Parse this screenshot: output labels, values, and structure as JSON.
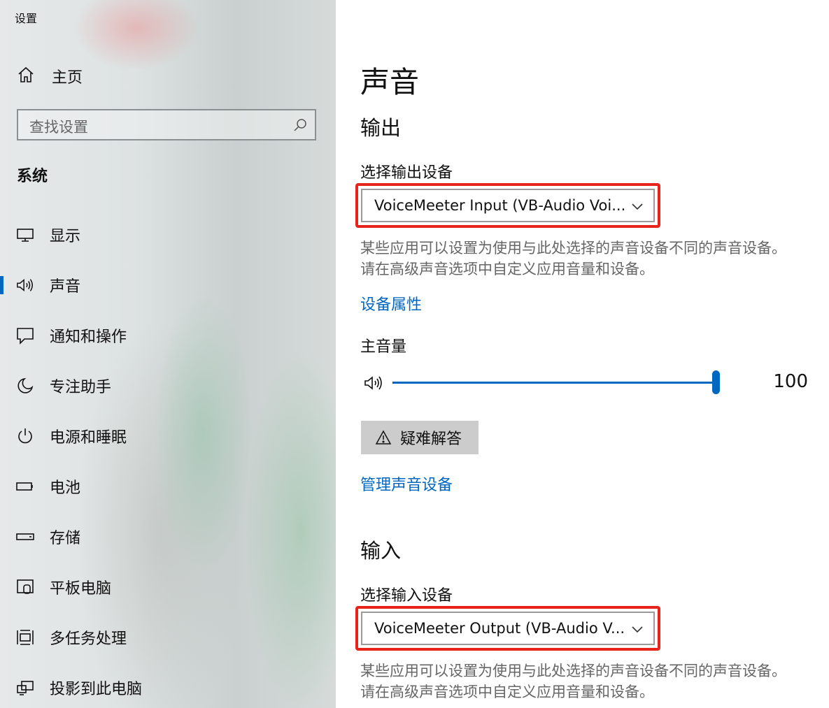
{
  "window": {
    "title": "设置"
  },
  "sidebar": {
    "home_label": "主页",
    "search_placeholder": "查找设置",
    "section_label": "系统",
    "items": [
      {
        "label": "显示",
        "icon": "monitor-icon"
      },
      {
        "label": "声音",
        "icon": "speaker-icon",
        "active": true
      },
      {
        "label": "通知和操作",
        "icon": "notification-icon"
      },
      {
        "label": "专注助手",
        "icon": "moon-icon"
      },
      {
        "label": "电源和睡眠",
        "icon": "power-icon"
      },
      {
        "label": "电池",
        "icon": "battery-icon"
      },
      {
        "label": "存储",
        "icon": "storage-icon"
      },
      {
        "label": "平板电脑",
        "icon": "tablet-icon"
      },
      {
        "label": "多任务处理",
        "icon": "multitask-icon"
      },
      {
        "label": "投影到此电脑",
        "icon": "project-icon"
      }
    ]
  },
  "main": {
    "title": "声音",
    "output": {
      "heading": "输出",
      "select_label": "选择输出设备",
      "device": "VoiceMeeter Input (VB-Audio Voi...",
      "description_line1": "某些应用可以设置为使用与此处选择的声音设备不同的声音设备。",
      "description_line2": "请在高级声音选项中自定义应用音量和设备。",
      "properties_link": "设备属性",
      "volume_label": "主音量",
      "volume_value": "100",
      "troubleshoot_label": "疑难解答",
      "manage_link": "管理声音设备"
    },
    "input": {
      "heading": "输入",
      "select_label": "选择输入设备",
      "device": "VoiceMeeter Output (VB-Audio V...",
      "description_line1": "某些应用可以设置为使用与此处选择的声音设备不同的声音设备。",
      "description_line2": "请在高级声音选项中自定义应用音量和设备。"
    }
  },
  "colors": {
    "accent": "#0067c0",
    "highlight_box": "#e8231c",
    "button_bg": "#cccccc"
  }
}
